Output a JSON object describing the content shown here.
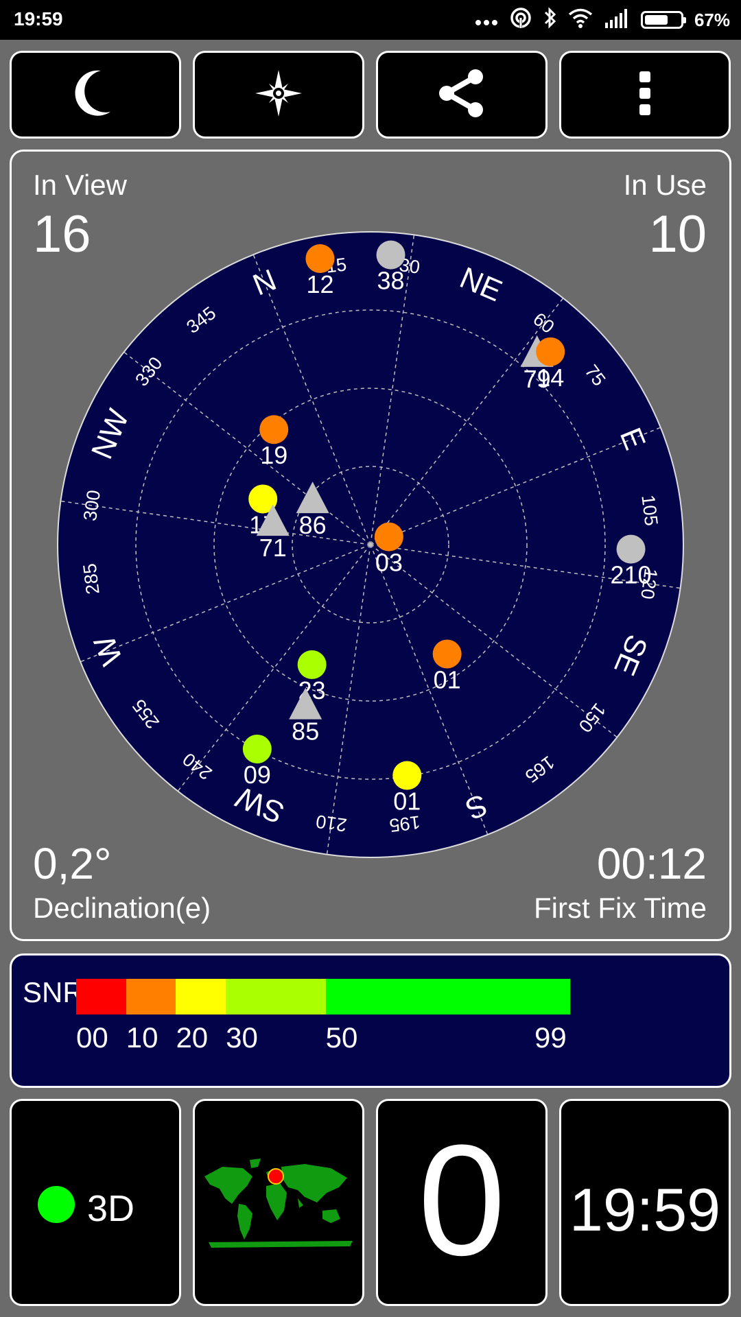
{
  "status_bar": {
    "time": "19:59",
    "battery_percent": "67%",
    "battery_level": 0.67,
    "icons": [
      "more-dots-icon",
      "hotspot-icon",
      "bluetooth-icon",
      "wifi-icon",
      "signal-icon",
      "battery-icon"
    ]
  },
  "toolbar": {
    "buttons": [
      {
        "name": "night-mode-button",
        "icon": "moon-icon"
      },
      {
        "name": "compass-button",
        "icon": "compass-star-icon"
      },
      {
        "name": "share-button",
        "icon": "share-icon"
      },
      {
        "name": "menu-button",
        "icon": "more-vertical-icon"
      }
    ]
  },
  "radar": {
    "in_view_label": "In View",
    "in_view_value": "16",
    "in_use_label": "In Use",
    "in_use_value": "10",
    "declination_value": "0,2°",
    "declination_label": "Declination(e)",
    "first_fix_value": "00:12",
    "first_fix_label": "First Fix Time",
    "colors": {
      "background": "#03034a",
      "border": "#dcdcdc",
      "grid": "#bfbfbf"
    },
    "rotation_deg": -22,
    "cardinals": [
      {
        "label": "N",
        "az": 0
      },
      {
        "label": "NE",
        "az": 45
      },
      {
        "label": "E",
        "az": 90
      },
      {
        "label": "SE",
        "az": 135
      },
      {
        "label": "S",
        "az": 180
      },
      {
        "label": "SW",
        "az": 225
      },
      {
        "label": "W",
        "az": 270
      },
      {
        "label": "NW",
        "az": 315
      }
    ],
    "degree_labels": [
      {
        "label": "15",
        "az": 15
      },
      {
        "label": "30",
        "az": 30
      },
      {
        "label": "60",
        "az": 60
      },
      {
        "label": "75",
        "az": 75
      },
      {
        "label": "105",
        "az": 105
      },
      {
        "label": "120",
        "az": 120
      },
      {
        "label": "150",
        "az": 150
      },
      {
        "label": "165",
        "az": 165
      },
      {
        "label": "195",
        "az": 195
      },
      {
        "label": "210",
        "az": 210
      },
      {
        "label": "240",
        "az": 240
      },
      {
        "label": "255",
        "az": 255
      },
      {
        "label": "285",
        "az": 285
      },
      {
        "label": "300",
        "az": 300
      },
      {
        "label": "330",
        "az": 330
      },
      {
        "label": "345",
        "az": 345
      }
    ],
    "satellites": [
      {
        "id": "12",
        "az": 12,
        "elev": 3,
        "shape": "circle",
        "color": "#ff7f00"
      },
      {
        "id": "38",
        "az": 26,
        "elev": 3,
        "shape": "circle",
        "color": "#c0c0c0"
      },
      {
        "id": "19",
        "az": 342,
        "elev": 45,
        "shape": "circle",
        "color": "#ff7f00"
      },
      {
        "id": "17",
        "az": 315,
        "elev": 55,
        "shape": "circle",
        "color": "#ffff00"
      },
      {
        "id": "71",
        "az": 305,
        "elev": 60,
        "shape": "triangle",
        "color": "#c0c0c0"
      },
      {
        "id": "86",
        "az": 330,
        "elev": 68,
        "shape": "triangle",
        "color": "#c0c0c0"
      },
      {
        "id": "03",
        "az": 89,
        "elev": 84,
        "shape": "circle",
        "color": "#ff7f00"
      },
      {
        "id": "79",
        "az": 63,
        "elev": 14,
        "shape": "triangle",
        "color": "#c0c0c0"
      },
      {
        "id": "14",
        "az": 65,
        "elev": 11,
        "shape": "circle",
        "color": "#ff7f00"
      },
      {
        "id": "09",
        "az": 231,
        "elev": 20,
        "shape": "circle",
        "color": "#aaff00"
      },
      {
        "id": "23",
        "az": 228,
        "elev": 50,
        "shape": "circle",
        "color": "#aaff00"
      },
      {
        "id": "85",
        "az": 224,
        "elev": 38,
        "shape": "triangle",
        "color": "#c0c0c0"
      },
      {
        "id": "01",
        "az": 167,
        "elev": 50,
        "shape": "circle",
        "color": "#ff7f00"
      },
      {
        "id": "01",
        "az": 193,
        "elev": 20,
        "shape": "circle",
        "color": "#ffff00"
      },
      {
        "id": "210",
        "az": 113,
        "elev": 12,
        "shape": "circle",
        "color": "#c0c0c0"
      }
    ]
  },
  "snr": {
    "title": "SNR",
    "segments": [
      {
        "from": 0,
        "to": 10,
        "color": "#ff0000"
      },
      {
        "from": 10,
        "to": 20,
        "color": "#ff7f00"
      },
      {
        "from": 20,
        "to": 30,
        "color": "#ffff00"
      },
      {
        "from": 30,
        "to": 50,
        "color": "#aaff00"
      },
      {
        "from": 50,
        "to": 99,
        "color": "#00ff00"
      }
    ],
    "ticks": [
      "00",
      "10",
      "20",
      "30",
      "50",
      "99"
    ]
  },
  "bottom": {
    "fix_mode": "3D",
    "fix_color": "#00ff00",
    "map_land_color": "#109b10",
    "marker_color": "#ff0000",
    "speed_value": "0",
    "clock": "19:59"
  }
}
